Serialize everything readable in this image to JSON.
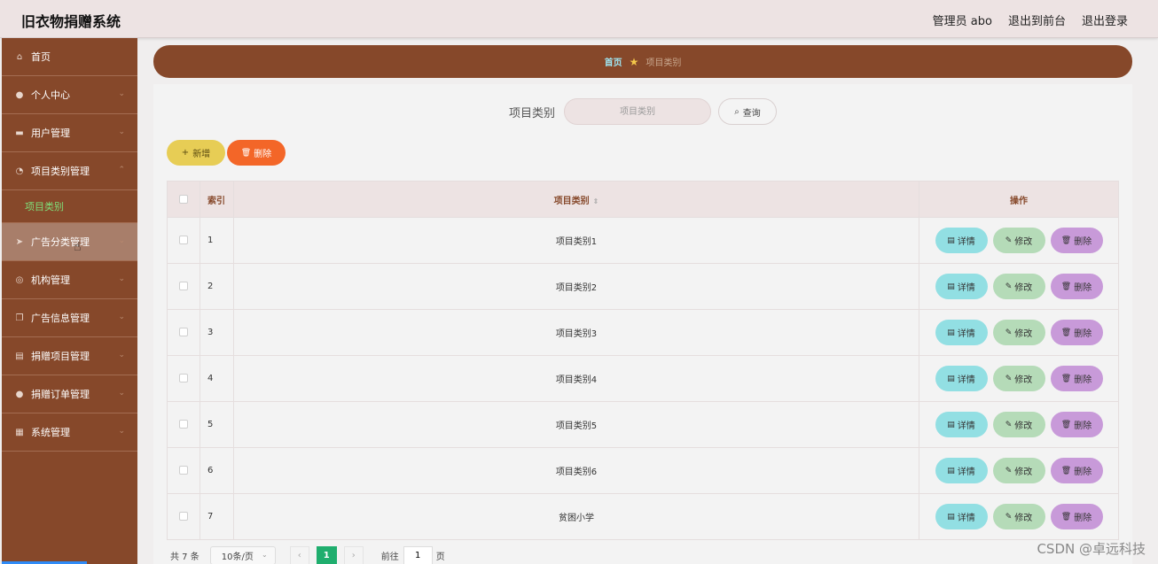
{
  "header": {
    "app_title": "旧衣物捐赠系统",
    "admin_label": "管理员 abo",
    "back_to_front": "退出到前台",
    "logout": "退出登录"
  },
  "sidebar": {
    "items": [
      {
        "label": "首页",
        "icon": "home-icon"
      },
      {
        "label": "个人中心",
        "icon": "user-icon"
      },
      {
        "label": "用户管理",
        "icon": "monitor-icon"
      },
      {
        "label": "项目类别管理",
        "icon": "gauge-icon"
      },
      {
        "label": "广告分类管理",
        "icon": "send-icon"
      },
      {
        "label": "机构管理",
        "icon": "compass-icon"
      },
      {
        "label": "广告信息管理",
        "icon": "copy-icon"
      },
      {
        "label": "捐赠项目管理",
        "icon": "document-icon"
      },
      {
        "label": "捐赠订单管理",
        "icon": "location-icon"
      },
      {
        "label": "系统管理",
        "icon": "briefcase-icon"
      }
    ],
    "sub_item": "项目类别"
  },
  "breadcrumb": {
    "home": "首页",
    "current": "项目类别"
  },
  "search": {
    "label": "项目类别",
    "placeholder": "项目类别",
    "query_button": "查询"
  },
  "actions": {
    "add": "新增",
    "delete": "删除"
  },
  "table": {
    "headers": {
      "index": "索引",
      "name": "项目类别",
      "ops": "操作"
    },
    "rows": [
      {
        "index": "1",
        "name": "项目类别1"
      },
      {
        "index": "2",
        "name": "项目类别2"
      },
      {
        "index": "3",
        "name": "项目类别3"
      },
      {
        "index": "4",
        "name": "项目类别4"
      },
      {
        "index": "5",
        "name": "项目类别5"
      },
      {
        "index": "6",
        "name": "项目类别6"
      },
      {
        "index": "7",
        "name": "贫困小学"
      }
    ],
    "op_labels": {
      "detail": "详情",
      "edit": "修改",
      "delete": "删除"
    }
  },
  "pagination": {
    "total": "共 7 条",
    "page_size": "10条/页",
    "current_page": "1",
    "goto_label": "前往",
    "goto_value": "1",
    "unit": "页"
  },
  "watermark": "CSDN @卓远科技",
  "colors": {
    "sidebar": "#86482a",
    "header": "#ede3e3",
    "accent_green": "#1fae6e",
    "add_button": "#e7cd55",
    "delete_button": "#f36628"
  }
}
